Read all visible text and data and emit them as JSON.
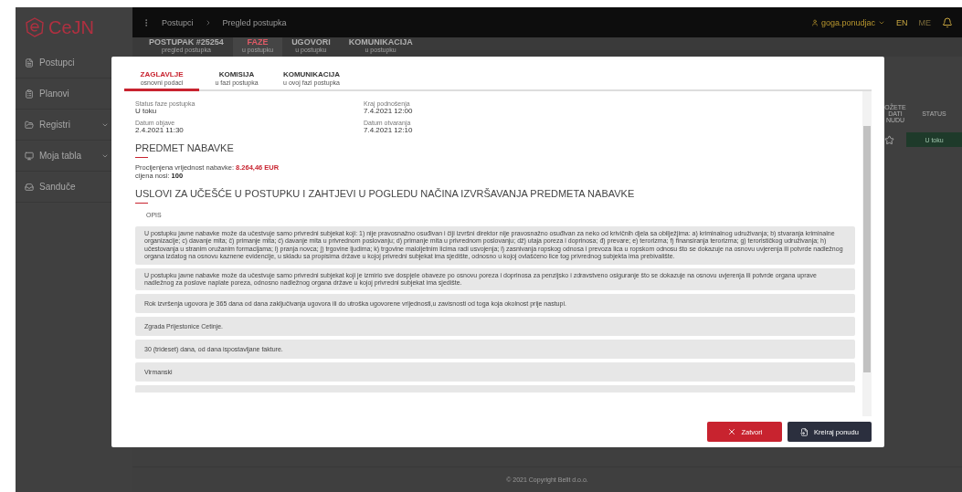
{
  "app": {
    "logo": "CeJN",
    "breadcrumb": [
      "Postupci",
      "Pregled postupka"
    ],
    "user": "goga.ponudjac",
    "languages": [
      {
        "label": "EN",
        "selected": true
      },
      {
        "label": "ME",
        "selected": false
      }
    ]
  },
  "sidebar": {
    "items": [
      {
        "label": "Postupci",
        "expandable": false
      },
      {
        "label": "Planovi",
        "expandable": false
      },
      {
        "label": "Registri",
        "expandable": true
      },
      {
        "label": "Moja tabla",
        "expandable": true
      },
      {
        "label": "Sanduče",
        "expandable": false
      }
    ]
  },
  "page_tabs": [
    {
      "label": "POSTUPAK #25254",
      "sublabel": "pregled postupka",
      "selected": false
    },
    {
      "label": "FAZE",
      "sublabel": "u postupku",
      "selected": true
    },
    {
      "label": "UGOVORI",
      "sublabel": "u postupku",
      "selected": false
    },
    {
      "label": "KOMUNIKACIJA",
      "sublabel": "u postupku",
      "selected": false
    }
  ],
  "table": {
    "columns": [
      "OŽETE\nDATI\nNUDU",
      "STATUS"
    ],
    "rows": [
      {
        "status": "U toku"
      }
    ]
  },
  "footer": "© 2021 Copyright Bellt d.o.o.",
  "modal": {
    "tabs": [
      {
        "label": "ZAGLAVLJE",
        "sublabel": "osnovni podaci",
        "selected": true
      },
      {
        "label": "KOMISIJA",
        "sublabel": "u fazi postupka",
        "selected": false
      },
      {
        "label": "KOMUNIKACIJA",
        "sublabel": "u ovoj fazi postupka",
        "selected": false
      }
    ],
    "fields": [
      {
        "label": "Status faze postupka",
        "value": "U toku"
      },
      {
        "label": "Kraj podnošenja",
        "value": "7.4.2021 12:00"
      },
      {
        "label": "Datum objave",
        "value": "2.4.2021 11:30"
      },
      {
        "label": "Datum otvaranja",
        "value": "7.4.2021 12:10"
      }
    ],
    "sections": [
      {
        "title": "PREDMET NABAVKE",
        "lines": [
          {
            "text": "Procijenjena vrijednost nabavke: **8.264,46 EUR**",
            "accent": true
          },
          {
            "text": "cijena nosi: **100**",
            "accent": false
          }
        ]
      },
      {
        "title": "USLOVI ZA UČEŠĆE U POSTUPKU I ZAHTJEVI U POGLEDU NAČINA IZVRŠAVANJA PREDMETA NABAVKE",
        "label": "OPIS",
        "paragraphs": [
          "U postupku javne nabavke može da učestvuje samo privredni subjekat koji: 1) nije pravosnažno osuđivan i čiji izvršni direktor nije pravosnažno osuđivan za neko od krivičnih djela sa obilježjima: a) kriminalnog udruživanja; b) stvaranja kriminalne organizacije; c) davanje mita; č) primanje mita; ć) davanje mita u privrednom poslovanju; d) primanje mita u privrednom poslovanju; dž) utaja poreza i doprinosa; đ) prevare; e) terorizma; f) finansiranja terorizma; g) terorističkog udruživanja; h) učestovanja u stranim oružanim formacijama; i) pranja novca; j) trgovine ljudima; k) trgovine maloljetnim licima radi usvojenja; l) zasnivanja ropskog odnosa i prevoza lica u ropskom odnosu što se dokazuje na osnovu uvjerenja ili potvrde nadležnog organa izdatog na osnovu kaznene evidencije, u skladu sa propisima države u kojoj privredni subjekat ima sjedište, odnosno u kojoj ovlašćeno lice tog privrednog subjekta ima prebivalište.",
          "U postupku javne nabavke može da učestvuje samo privredni subjekat koji je izmirio sve dospjele obaveze po osnovu poreza i doprinosa za penzijsko i zdravstveno osiguranje što se dokazuje na osnovu uvjerenja ili potvrde organa uprave nadležnog za poslove naplate poreza, odnosno nadležnog organa države u kojoj privredni subjekat ima sjedište.",
          "Rok izvršenja ugovora je 365 dana od dana zaključivanja ugovora ili do utroška ugovorene vrijednosti,u zavisnosti od toga koja okolnost prije nastupi.",
          "Zgrada Prijestonice Cetinje.",
          "30 (trideset) dana, od dana ispostavljane fakture.",
          "Virmanski"
        ]
      }
    ],
    "buttons": [
      {
        "label": "Zatvori",
        "kind": "danger"
      },
      {
        "label": "Kreiraj ponudu",
        "kind": "primary"
      }
    ]
  }
}
